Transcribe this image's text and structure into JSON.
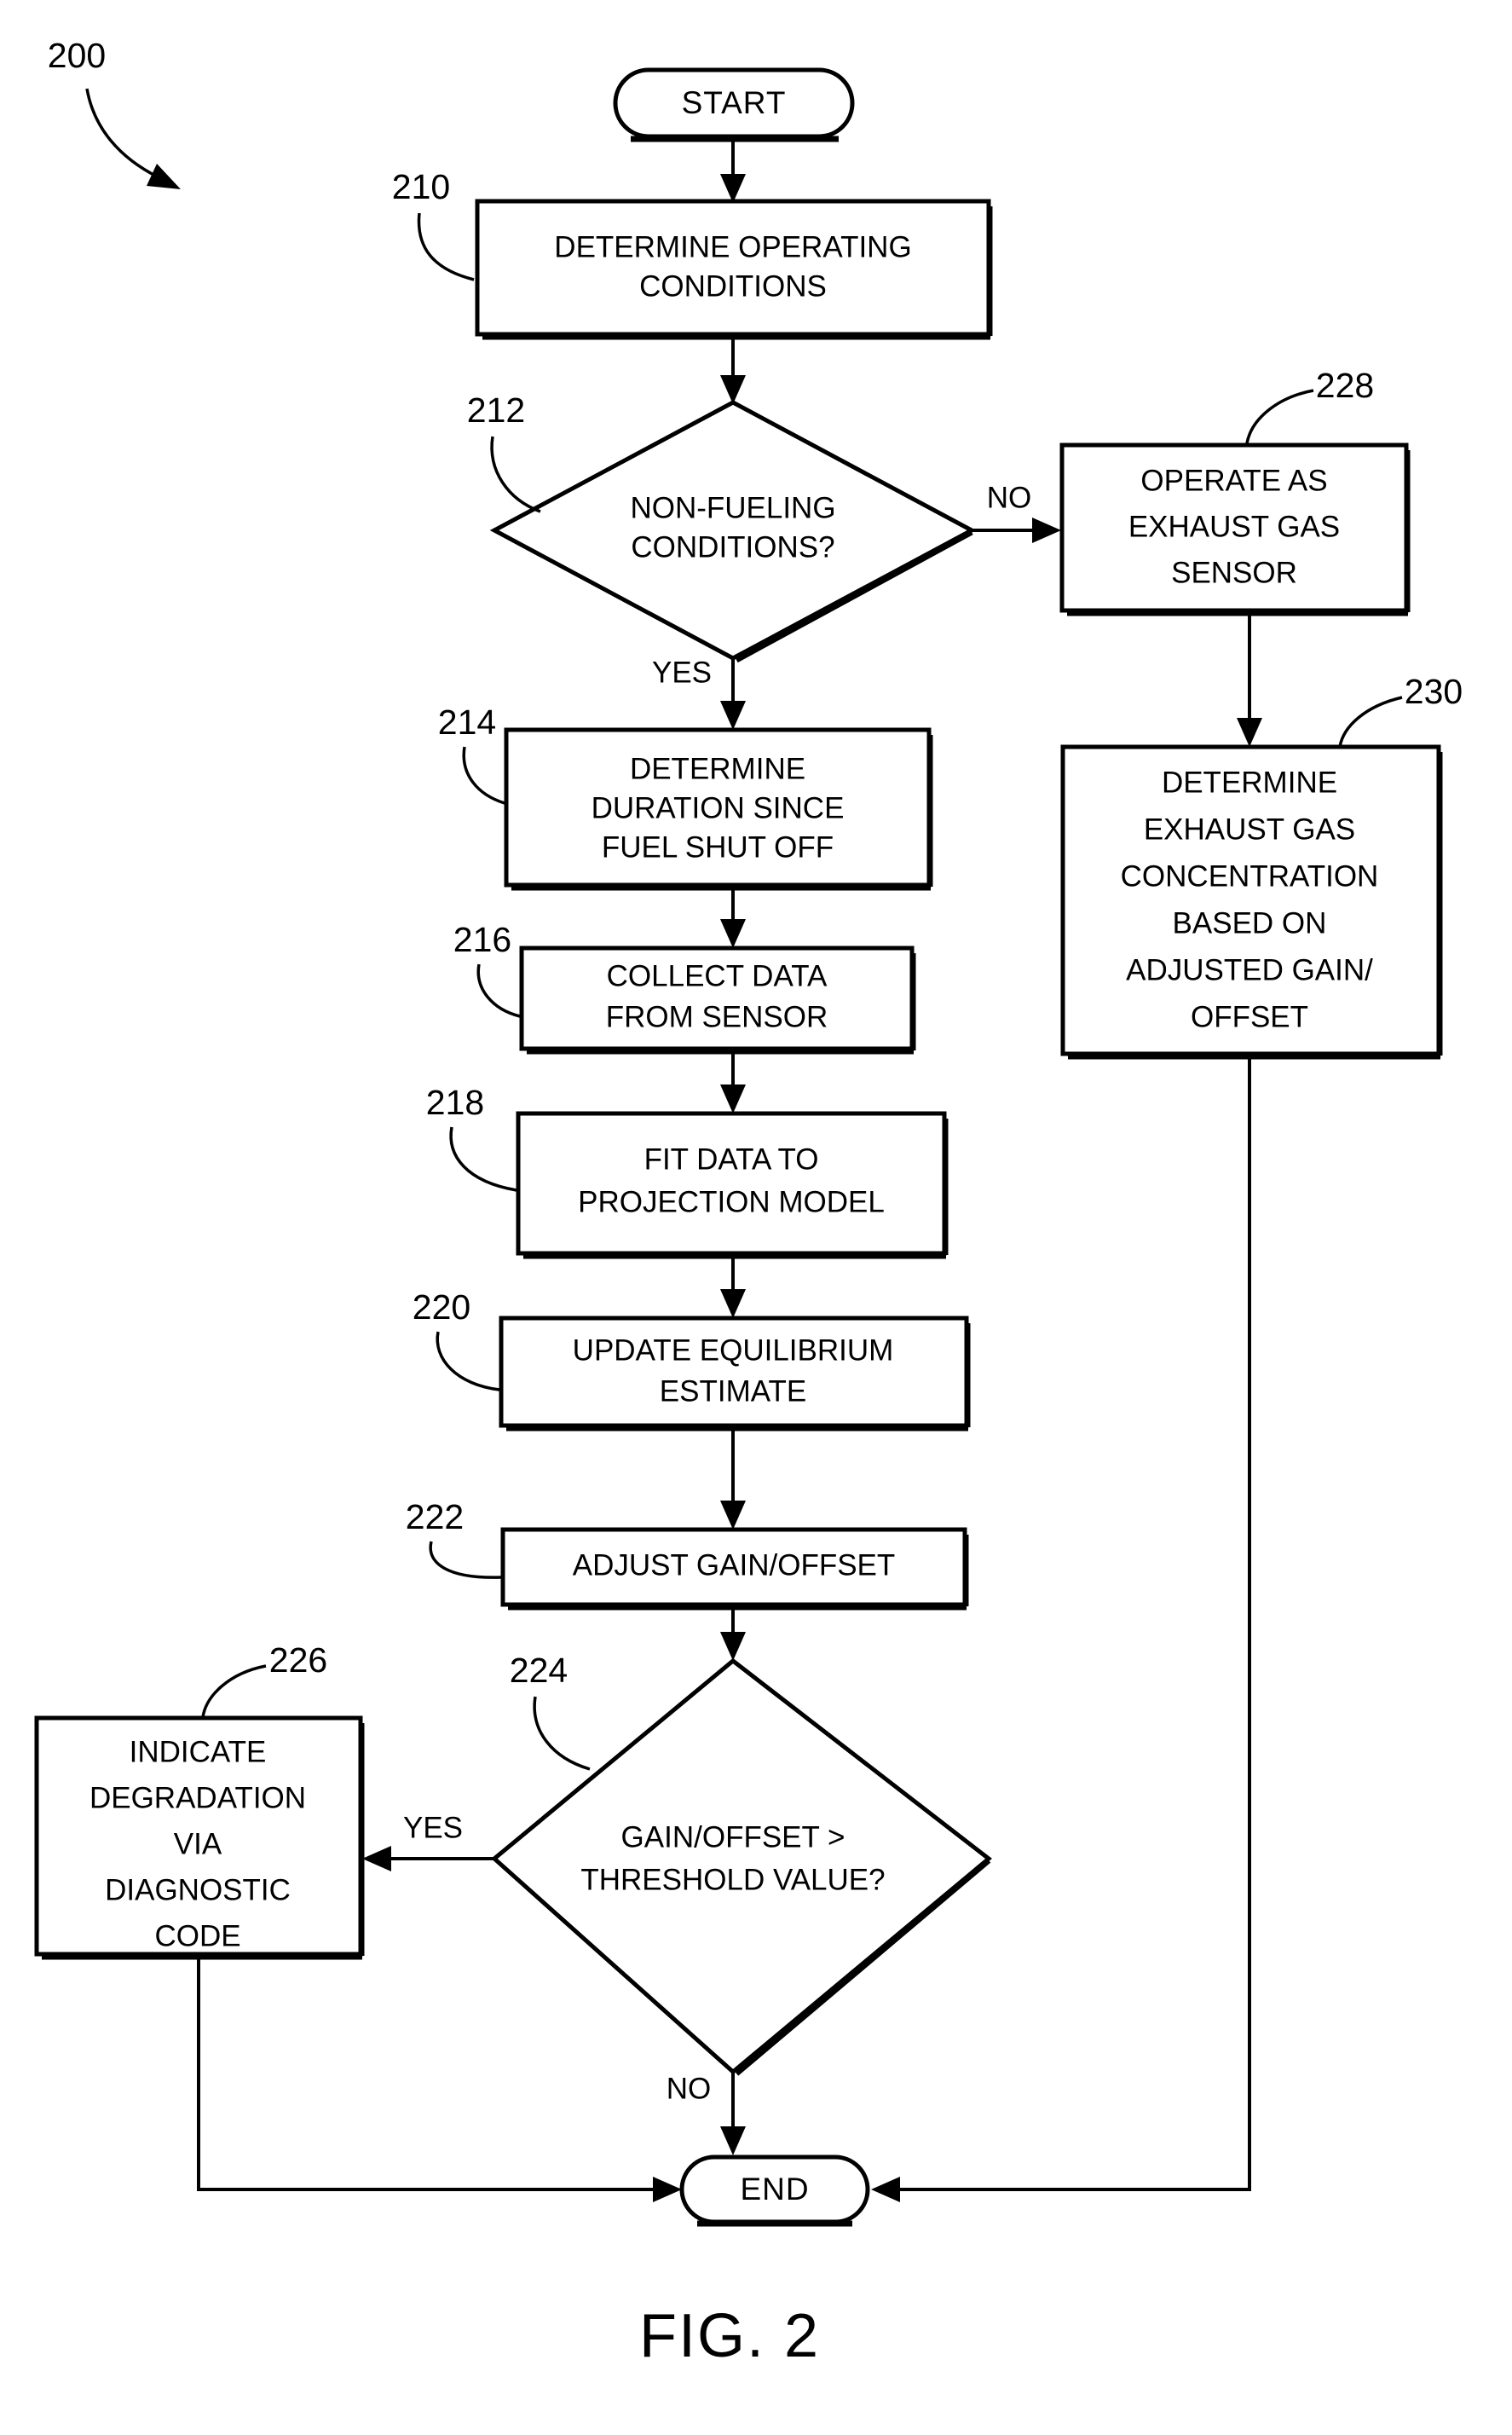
{
  "figure": {
    "caption": "FIG. 2",
    "diagram_ref": "200",
    "title": "Flowchart 200 - exhaust gas sensor gain/offset adjustment method"
  },
  "terminals": {
    "start": "START",
    "end": "END"
  },
  "nodes": {
    "n210": {
      "ref": "210",
      "type": "process",
      "lines": [
        "DETERMINE OPERATING",
        "CONDITIONS"
      ]
    },
    "n212": {
      "ref": "212",
      "type": "decision",
      "lines": [
        "NON-FUELING",
        "CONDITIONS?"
      ]
    },
    "n214": {
      "ref": "214",
      "type": "process",
      "lines": [
        "DETERMINE",
        "DURATION SINCE",
        "FUEL SHUT OFF"
      ]
    },
    "n216": {
      "ref": "216",
      "type": "process",
      "lines": [
        "COLLECT DATA",
        "FROM SENSOR"
      ]
    },
    "n218": {
      "ref": "218",
      "type": "process",
      "lines": [
        "FIT DATA TO",
        "PROJECTION MODEL"
      ]
    },
    "n220": {
      "ref": "220",
      "type": "process",
      "lines": [
        "UPDATE EQUILIBRIUM",
        "ESTIMATE"
      ]
    },
    "n222": {
      "ref": "222",
      "type": "process",
      "lines": [
        "ADJUST GAIN/OFFSET"
      ]
    },
    "n224": {
      "ref": "224",
      "type": "decision",
      "lines": [
        "GAIN/OFFSET >",
        "THRESHOLD VALUE?"
      ]
    },
    "n226": {
      "ref": "226",
      "type": "process",
      "lines": [
        "INDICATE",
        "DEGRADATION",
        "VIA",
        "DIAGNOSTIC",
        "CODE"
      ]
    },
    "n228": {
      "ref": "228",
      "type": "process",
      "lines": [
        "OPERATE AS",
        "EXHAUST GAS",
        "SENSOR"
      ]
    },
    "n230": {
      "ref": "230",
      "type": "process",
      "lines": [
        "DETERMINE",
        "EXHAUST GAS",
        "CONCENTRATION",
        "BASED ON",
        "ADJUSTED GAIN/",
        "OFFSET"
      ]
    }
  },
  "branch_labels": {
    "d212_no": "NO",
    "d212_yes": "YES",
    "d224_yes": "YES",
    "d224_no": "NO"
  },
  "colors": {
    "line": "#000000",
    "fill": "#ffffff",
    "text": "#000000"
  }
}
